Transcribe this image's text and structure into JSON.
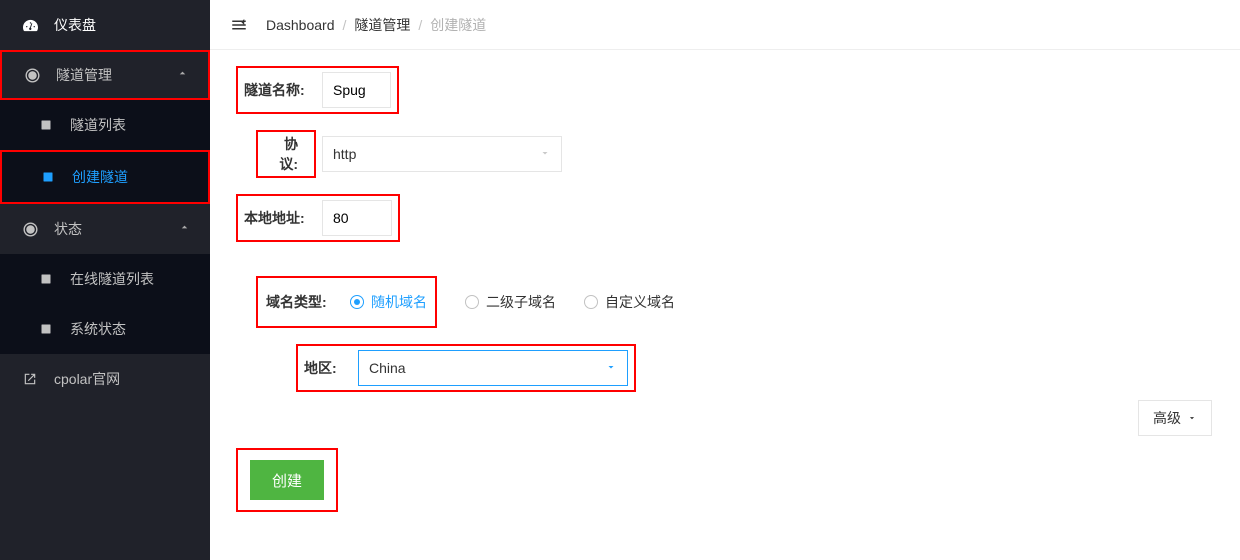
{
  "sidebar": {
    "items": [
      {
        "label": "仪表盘"
      },
      {
        "label": "隧道管理"
      },
      {
        "label": "状态"
      },
      {
        "label": "cpolar官网"
      }
    ],
    "tunnel_sub": [
      {
        "label": "隧道列表"
      },
      {
        "label": "创建隧道"
      }
    ],
    "status_sub": [
      {
        "label": "在线隧道列表"
      },
      {
        "label": "系统状态"
      }
    ]
  },
  "breadcrumb": {
    "item0": "Dashboard",
    "item1": "隧道管理",
    "item2": "创建隧道"
  },
  "form": {
    "tunnel_name_label": "隧道名称:",
    "tunnel_name_value": "Spug",
    "protocol_label": "协议:",
    "protocol_value": "http",
    "local_addr_label": "本地地址:",
    "local_addr_value": "80",
    "domain_type_label": "域名类型:",
    "domain_opts": [
      {
        "label": "随机域名"
      },
      {
        "label": "二级子域名"
      },
      {
        "label": "自定义域名"
      }
    ],
    "region_label": "地区:",
    "region_value": "China",
    "advanced_label": "高级",
    "create_label": "创建"
  }
}
